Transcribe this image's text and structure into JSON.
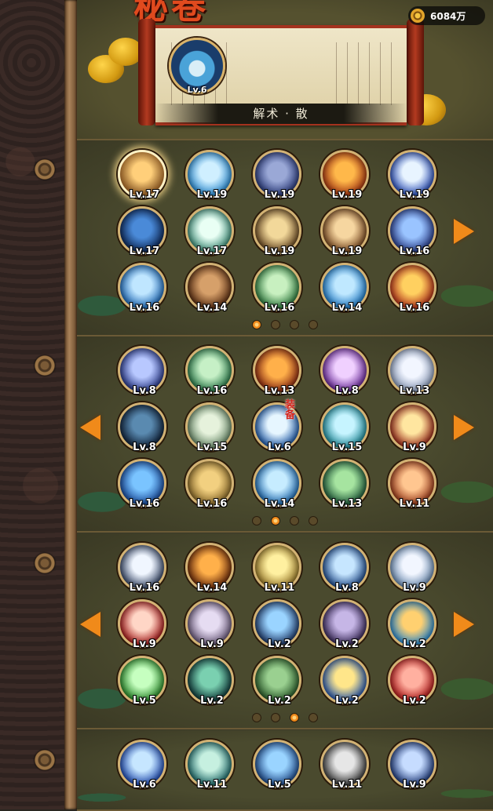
{
  "header": {
    "title": "秘卷",
    "currency": {
      "icon": "coin-icon",
      "value": "6084万"
    }
  },
  "featured": {
    "level": "Lv.6",
    "name": "解术 · 散"
  },
  "panels": [
    {
      "rows": [
        [
          {
            "level": "Lv.17",
            "colors": [
              "#ffcf7a",
              "#7a4a1a"
            ],
            "selected": true
          },
          {
            "level": "Lv.19",
            "colors": [
              "#cfefff",
              "#2a8ad0"
            ]
          },
          {
            "level": "Lv.19",
            "colors": [
              "#9aa8d6",
              "#2a3a7a"
            ]
          },
          {
            "level": "Lv.19",
            "colors": [
              "#ffb84a",
              "#a63612"
            ]
          },
          {
            "level": "Lv.19",
            "colors": [
              "#e8f4ff",
              "#2b4fb8"
            ]
          }
        ],
        [
          {
            "level": "Lv.17",
            "colors": [
              "#4a8ad8",
              "#0f2a5a"
            ]
          },
          {
            "level": "Lv.17",
            "colors": [
              "#e9fff4",
              "#3f8f7a"
            ]
          },
          {
            "level": "Lv.19",
            "colors": [
              "#f2d89a",
              "#6a4a24"
            ]
          },
          {
            "level": "Lv.19",
            "colors": [
              "#f6d6a0",
              "#7a4a22"
            ]
          },
          {
            "level": "Lv.16",
            "colors": [
              "#9ac4ff",
              "#2a3e8a"
            ]
          }
        ],
        [
          {
            "level": "Lv.16",
            "colors": [
              "#bfe6ff",
              "#1f6ab8"
            ]
          },
          {
            "level": "Lv.14",
            "colors": [
              "#d6a06a",
              "#5a2e12"
            ]
          },
          {
            "level": "Lv.16",
            "colors": [
              "#c8f0c0",
              "#2e7a3e"
            ]
          },
          {
            "level": "Lv.14",
            "colors": [
              "#bfe8ff",
              "#1f7ac6"
            ]
          },
          {
            "level": "Lv.16",
            "colors": [
              "#ffd060",
              "#b2301a"
            ]
          }
        ]
      ],
      "page_count": 4,
      "active_page": 1,
      "left_arrow": false,
      "right_arrow": true
    },
    {
      "rows": [
        [
          {
            "level": "Lv.8",
            "colors": [
              "#b8c8ff",
              "#2a3a8a"
            ]
          },
          {
            "level": "Lv.16",
            "colors": [
              "#c6f0c6",
              "#2a7a4a"
            ]
          },
          {
            "level": "Lv.13",
            "colors": [
              "#ffb04a",
              "#8a2a12"
            ]
          },
          {
            "level": "Lv.8",
            "colors": [
              "#f0d0ff",
              "#6a2a9a"
            ]
          },
          {
            "level": "Lv.13",
            "colors": [
              "#f2f6ff",
              "#8a9ab8"
            ]
          }
        ],
        [
          {
            "level": "Lv.8",
            "colors": [
              "#5a8ab0",
              "#10223a"
            ]
          },
          {
            "level": "Lv.15",
            "colors": [
              "#e6f2dc",
              "#6a8a6a"
            ]
          },
          {
            "level": "Lv.6",
            "colors": [
              "#e6f6ff",
              "#1f5aa8"
            ],
            "equipped": "装备"
          },
          {
            "level": "Lv.15",
            "colors": [
              "#c6f4ff",
              "#1f8a9a"
            ]
          },
          {
            "level": "Lv.9",
            "colors": [
              "#ffe6a0",
              "#9a2a1a"
            ]
          }
        ],
        [
          {
            "level": "Lv.16",
            "colors": [
              "#7ac4ff",
              "#1a4a9a"
            ]
          },
          {
            "level": "Lv.16",
            "colors": [
              "#f2d080",
              "#8a6a2a"
            ]
          },
          {
            "level": "Lv.14",
            "colors": [
              "#c6ecff",
              "#1f6ab0"
            ]
          },
          {
            "level": "Lv.13",
            "colors": [
              "#a6e4a0",
              "#1f5a3a"
            ]
          },
          {
            "level": "Lv.11",
            "colors": [
              "#ffc690",
              "#9a3a1a"
            ]
          }
        ]
      ],
      "page_count": 4,
      "active_page": 2,
      "left_arrow": true,
      "right_arrow": true
    },
    {
      "rows": [
        [
          {
            "level": "Lv.16",
            "colors": [
              "#f0f6ff",
              "#3a4a6a"
            ]
          },
          {
            "level": "Lv.14",
            "colors": [
              "#ffb04a",
              "#6a2a0a"
            ]
          },
          {
            "level": "Lv.11",
            "colors": [
              "#fff0a0",
              "#9a7a2a"
            ]
          },
          {
            "level": "Lv.8",
            "colors": [
              "#c6e6ff",
              "#1f4a8a"
            ]
          },
          {
            "level": "Lv.9",
            "colors": [
              "#f2f6ff",
              "#6a8ab0"
            ]
          }
        ],
        [
          {
            "level": "Lv.9",
            "colors": [
              "#ffd6c6",
              "#a61a1a"
            ]
          },
          {
            "level": "Lv.9",
            "colors": [
              "#e6dcf2",
              "#6a5a7a"
            ]
          },
          {
            "level": "Lv.2",
            "colors": [
              "#9ad4ff",
              "#1f3a6a"
            ]
          },
          {
            "level": "Lv.2",
            "colors": [
              "#c6b6e6",
              "#3a2a5a"
            ]
          },
          {
            "level": "Lv.2",
            "colors": [
              "#ffd070",
              "#2a8ad0"
            ]
          }
        ],
        [
          {
            "level": "Lv.5",
            "colors": [
              "#c6ffc0",
              "#2a8a2a"
            ]
          },
          {
            "level": "Lv.2",
            "colors": [
              "#7ad0b0",
              "#0f3a3a"
            ]
          },
          {
            "level": "Lv.2",
            "colors": [
              "#9ad090",
              "#2a5a2a"
            ]
          },
          {
            "level": "Lv.2",
            "colors": [
              "#ffe68a",
              "#2a5ab0"
            ]
          },
          {
            "level": "Lv.2",
            "colors": [
              "#ffb0a0",
              "#b21a1a"
            ]
          }
        ]
      ],
      "page_count": 4,
      "active_page": 3,
      "left_arrow": true,
      "right_arrow": true
    },
    {
      "rows": [
        [
          {
            "level": "Lv.6",
            "colors": [
              "#c6e6ff",
              "#1f4ab0"
            ]
          },
          {
            "level": "Lv.11",
            "colors": [
              "#c6f0e0",
              "#1f6a6a"
            ]
          },
          {
            "level": "Lv.5",
            "colors": [
              "#9ad4ff",
              "#1f4a8a"
            ]
          },
          {
            "level": "Lv.11",
            "colors": [
              "#e6e6e6",
              "#3a3a3a"
            ]
          },
          {
            "level": "Lv.9",
            "colors": [
              "#c6dcff",
              "#1f3a7a"
            ]
          }
        ]
      ],
      "page_count": 0,
      "active_page": 0,
      "left_arrow": false,
      "right_arrow": false
    }
  ]
}
